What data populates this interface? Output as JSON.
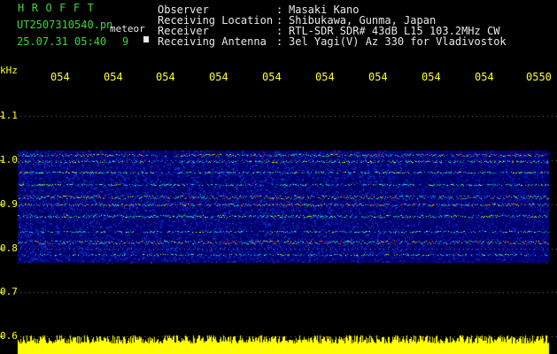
{
  "header": {
    "program": "HROFFT",
    "filename": "UT2507310540.pn",
    "file_type": "meteor",
    "datetime": "25.07.31 05:40",
    "count": "9",
    "labels": {
      "observer": "Observer",
      "location": "Receiving Location",
      "receiver": "Receiver",
      "antenna": "Receiving Antenna"
    },
    "separator": ":",
    "values": {
      "observer": "Masaki Kano",
      "location": "Shibukawa, Gunma, Japan",
      "receiver": "RTL-SDR SDR# 43dB L15 103.2MHz CW",
      "antenna": "3el Yagi(V) Az 330 for Vladivostok"
    }
  },
  "axis": {
    "unit": "kHz",
    "y_ticks": [
      "1.1",
      "1.0",
      "0.9",
      "0.8",
      "0.7",
      "0.6"
    ],
    "x_ticks": [
      "054",
      "054",
      "054",
      "054",
      "054",
      "054",
      "054",
      "054",
      "054",
      "0550"
    ]
  },
  "colors": {
    "text_green": "#3cd73c",
    "text_white": "#e8e8e8",
    "axis_yellow": "#ffff2a",
    "background": "#000000",
    "spectrogram_bg": "#000070"
  }
}
